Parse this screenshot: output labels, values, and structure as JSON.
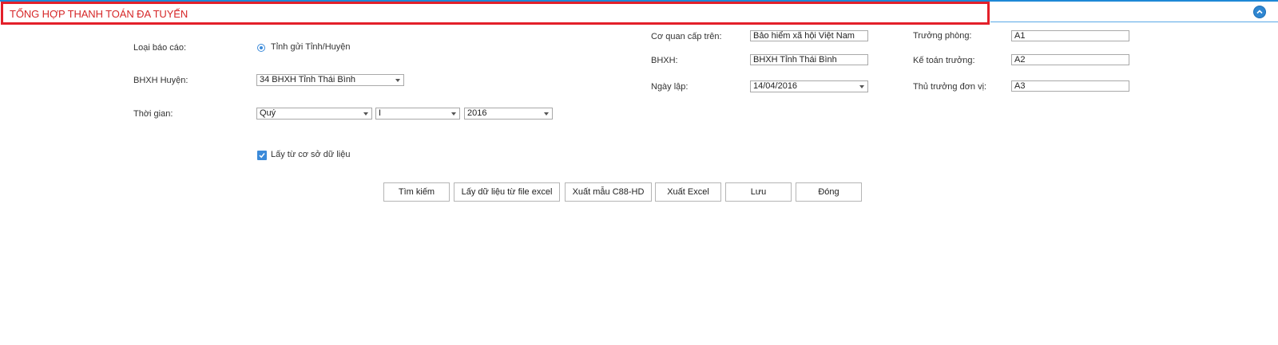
{
  "header": {
    "title": "TỔNG HỢP THANH TOÁN ĐA TUYẾN",
    "collapse_icon": "chevron-up-icon",
    "accent_color": "#1e88d6",
    "title_color": "#d62728"
  },
  "form": {
    "report_type_label": "Loại báo cáo:",
    "report_type_option": "Tỉnh gửi Tỉnh/Huyện",
    "district_label": "BHXH Huyện:",
    "district_value": "34 BHXH Tỉnh Thái Bình",
    "time_label": "Thời gian:",
    "time_period": "Quý",
    "time_quarter": "I",
    "time_year": "2016",
    "from_db_label": "Lấy từ cơ sở dữ liệu",
    "parent_agency_label": "Cơ quan cấp trên:",
    "parent_agency_value": "Bảo hiểm xã hội Việt Nam",
    "bhxh_label": "BHXH:",
    "bhxh_value": "BHXH Tỉnh Thái Bình",
    "date_label": "Ngày lập:",
    "date_value": "14/04/2016",
    "head_label": "Trưởng phòng:",
    "head_value": "A1",
    "accountant_label": "Kế toán trưởng:",
    "accountant_value": "A2",
    "director_label": "Thủ trưởng đơn vị:",
    "director_value": "A3"
  },
  "buttons": {
    "search": "Tìm kiếm",
    "import_excel": "Lấy dữ liệu từ file excel",
    "export_c88": "Xuất mẫu C88-HD",
    "export_excel": "Xuất Excel",
    "save": "Lưu",
    "close": "Đóng"
  }
}
